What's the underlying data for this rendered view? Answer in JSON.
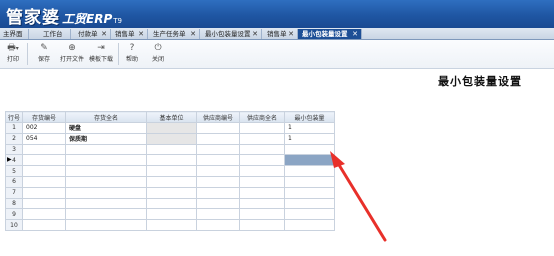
{
  "app": {
    "logo_cn": "管家婆",
    "logo_en": "工贸ERP",
    "logo_version": "T9"
  },
  "tabs": [
    {
      "label": "主界面",
      "closable": false,
      "active": false
    },
    {
      "label": "工作台",
      "closable": false,
      "active": false
    },
    {
      "label": "付款单",
      "closable": true,
      "active": false
    },
    {
      "label": "销售单",
      "closable": true,
      "active": false
    },
    {
      "label": "生产任务单",
      "closable": true,
      "active": false
    },
    {
      "label": "最小包装量设置",
      "closable": true,
      "active": false
    },
    {
      "label": "销售单",
      "closable": true,
      "active": false
    },
    {
      "label": "最小包装量设置",
      "closable": true,
      "active": true
    }
  ],
  "toolbar": {
    "print": "打印",
    "save": "保存",
    "open_file": "打开文件",
    "template_download": "模板下载",
    "help": "帮助",
    "close": "关闭"
  },
  "page_title": "最小包装量设置",
  "grid": {
    "columns": [
      "行号",
      "存货编号",
      "存货全名",
      "基本单位",
      "供应商编号",
      "供应商全名",
      "最小包装量"
    ],
    "rows": [
      {
        "no": "1",
        "code": "002",
        "name": "硬盘",
        "unit": "",
        "supplier_code": "",
        "supplier_name": "",
        "min_pack": "1"
      },
      {
        "no": "2",
        "code": "054",
        "name": "保质期",
        "unit": "",
        "supplier_code": "",
        "supplier_name": "",
        "min_pack": "1"
      },
      {
        "no": "3",
        "code": "",
        "name": "",
        "unit": "",
        "supplier_code": "",
        "supplier_name": "",
        "min_pack": ""
      },
      {
        "no": "4",
        "code": "",
        "name": "",
        "unit": "",
        "supplier_code": "",
        "supplier_name": "",
        "min_pack": ""
      },
      {
        "no": "5",
        "code": "",
        "name": "",
        "unit": "",
        "supplier_code": "",
        "supplier_name": "",
        "min_pack": ""
      },
      {
        "no": "6",
        "code": "",
        "name": "",
        "unit": "",
        "supplier_code": "",
        "supplier_name": "",
        "min_pack": ""
      },
      {
        "no": "7",
        "code": "",
        "name": "",
        "unit": "",
        "supplier_code": "",
        "supplier_name": "",
        "min_pack": ""
      },
      {
        "no": "8",
        "code": "",
        "name": "",
        "unit": "",
        "supplier_code": "",
        "supplier_name": "",
        "min_pack": ""
      },
      {
        "no": "9",
        "code": "",
        "name": "",
        "unit": "",
        "supplier_code": "",
        "supplier_name": "",
        "min_pack": ""
      },
      {
        "no": "10",
        "code": "",
        "name": "",
        "unit": "",
        "supplier_code": "",
        "supplier_name": "",
        "min_pack": ""
      }
    ],
    "current_row": "4"
  },
  "colors": {
    "titlebar": "#1f56a3",
    "active_tab": "#1d4f96",
    "selected_cell": "#8ba5c4",
    "annotation_arrow": "#e8302a"
  }
}
